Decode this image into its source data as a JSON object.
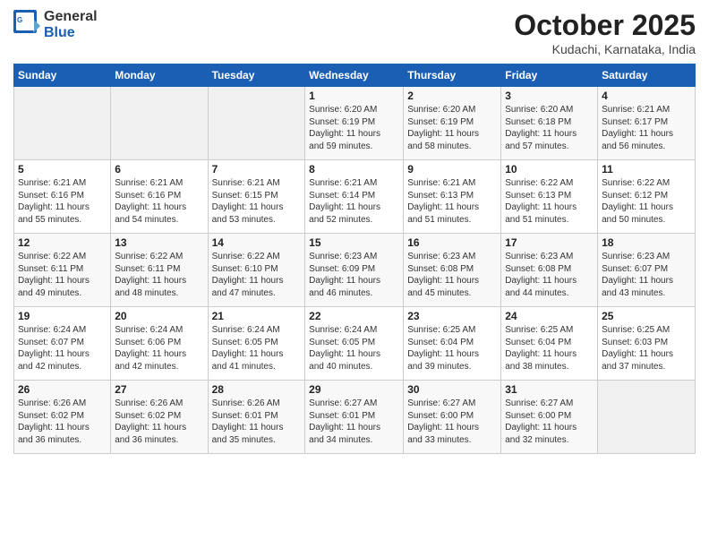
{
  "header": {
    "logo_line1": "General",
    "logo_line2": "Blue",
    "month": "October 2025",
    "location": "Kudachi, Karnataka, India"
  },
  "weekdays": [
    "Sunday",
    "Monday",
    "Tuesday",
    "Wednesday",
    "Thursday",
    "Friday",
    "Saturday"
  ],
  "weeks": [
    [
      {
        "day": "",
        "info": ""
      },
      {
        "day": "",
        "info": ""
      },
      {
        "day": "",
        "info": ""
      },
      {
        "day": "1",
        "info": "Sunrise: 6:20 AM\nSunset: 6:19 PM\nDaylight: 11 hours\nand 59 minutes."
      },
      {
        "day": "2",
        "info": "Sunrise: 6:20 AM\nSunset: 6:19 PM\nDaylight: 11 hours\nand 58 minutes."
      },
      {
        "day": "3",
        "info": "Sunrise: 6:20 AM\nSunset: 6:18 PM\nDaylight: 11 hours\nand 57 minutes."
      },
      {
        "day": "4",
        "info": "Sunrise: 6:21 AM\nSunset: 6:17 PM\nDaylight: 11 hours\nand 56 minutes."
      }
    ],
    [
      {
        "day": "5",
        "info": "Sunrise: 6:21 AM\nSunset: 6:16 PM\nDaylight: 11 hours\nand 55 minutes."
      },
      {
        "day": "6",
        "info": "Sunrise: 6:21 AM\nSunset: 6:16 PM\nDaylight: 11 hours\nand 54 minutes."
      },
      {
        "day": "7",
        "info": "Sunrise: 6:21 AM\nSunset: 6:15 PM\nDaylight: 11 hours\nand 53 minutes."
      },
      {
        "day": "8",
        "info": "Sunrise: 6:21 AM\nSunset: 6:14 PM\nDaylight: 11 hours\nand 52 minutes."
      },
      {
        "day": "9",
        "info": "Sunrise: 6:21 AM\nSunset: 6:13 PM\nDaylight: 11 hours\nand 51 minutes."
      },
      {
        "day": "10",
        "info": "Sunrise: 6:22 AM\nSunset: 6:13 PM\nDaylight: 11 hours\nand 51 minutes."
      },
      {
        "day": "11",
        "info": "Sunrise: 6:22 AM\nSunset: 6:12 PM\nDaylight: 11 hours\nand 50 minutes."
      }
    ],
    [
      {
        "day": "12",
        "info": "Sunrise: 6:22 AM\nSunset: 6:11 PM\nDaylight: 11 hours\nand 49 minutes."
      },
      {
        "day": "13",
        "info": "Sunrise: 6:22 AM\nSunset: 6:11 PM\nDaylight: 11 hours\nand 48 minutes."
      },
      {
        "day": "14",
        "info": "Sunrise: 6:22 AM\nSunset: 6:10 PM\nDaylight: 11 hours\nand 47 minutes."
      },
      {
        "day": "15",
        "info": "Sunrise: 6:23 AM\nSunset: 6:09 PM\nDaylight: 11 hours\nand 46 minutes."
      },
      {
        "day": "16",
        "info": "Sunrise: 6:23 AM\nSunset: 6:08 PM\nDaylight: 11 hours\nand 45 minutes."
      },
      {
        "day": "17",
        "info": "Sunrise: 6:23 AM\nSunset: 6:08 PM\nDaylight: 11 hours\nand 44 minutes."
      },
      {
        "day": "18",
        "info": "Sunrise: 6:23 AM\nSunset: 6:07 PM\nDaylight: 11 hours\nand 43 minutes."
      }
    ],
    [
      {
        "day": "19",
        "info": "Sunrise: 6:24 AM\nSunset: 6:07 PM\nDaylight: 11 hours\nand 42 minutes."
      },
      {
        "day": "20",
        "info": "Sunrise: 6:24 AM\nSunset: 6:06 PM\nDaylight: 11 hours\nand 42 minutes."
      },
      {
        "day": "21",
        "info": "Sunrise: 6:24 AM\nSunset: 6:05 PM\nDaylight: 11 hours\nand 41 minutes."
      },
      {
        "day": "22",
        "info": "Sunrise: 6:24 AM\nSunset: 6:05 PM\nDaylight: 11 hours\nand 40 minutes."
      },
      {
        "day": "23",
        "info": "Sunrise: 6:25 AM\nSunset: 6:04 PM\nDaylight: 11 hours\nand 39 minutes."
      },
      {
        "day": "24",
        "info": "Sunrise: 6:25 AM\nSunset: 6:04 PM\nDaylight: 11 hours\nand 38 minutes."
      },
      {
        "day": "25",
        "info": "Sunrise: 6:25 AM\nSunset: 6:03 PM\nDaylight: 11 hours\nand 37 minutes."
      }
    ],
    [
      {
        "day": "26",
        "info": "Sunrise: 6:26 AM\nSunset: 6:02 PM\nDaylight: 11 hours\nand 36 minutes."
      },
      {
        "day": "27",
        "info": "Sunrise: 6:26 AM\nSunset: 6:02 PM\nDaylight: 11 hours\nand 36 minutes."
      },
      {
        "day": "28",
        "info": "Sunrise: 6:26 AM\nSunset: 6:01 PM\nDaylight: 11 hours\nand 35 minutes."
      },
      {
        "day": "29",
        "info": "Sunrise: 6:27 AM\nSunset: 6:01 PM\nDaylight: 11 hours\nand 34 minutes."
      },
      {
        "day": "30",
        "info": "Sunrise: 6:27 AM\nSunset: 6:00 PM\nDaylight: 11 hours\nand 33 minutes."
      },
      {
        "day": "31",
        "info": "Sunrise: 6:27 AM\nSunset: 6:00 PM\nDaylight: 11 hours\nand 32 minutes."
      },
      {
        "day": "",
        "info": ""
      }
    ]
  ]
}
